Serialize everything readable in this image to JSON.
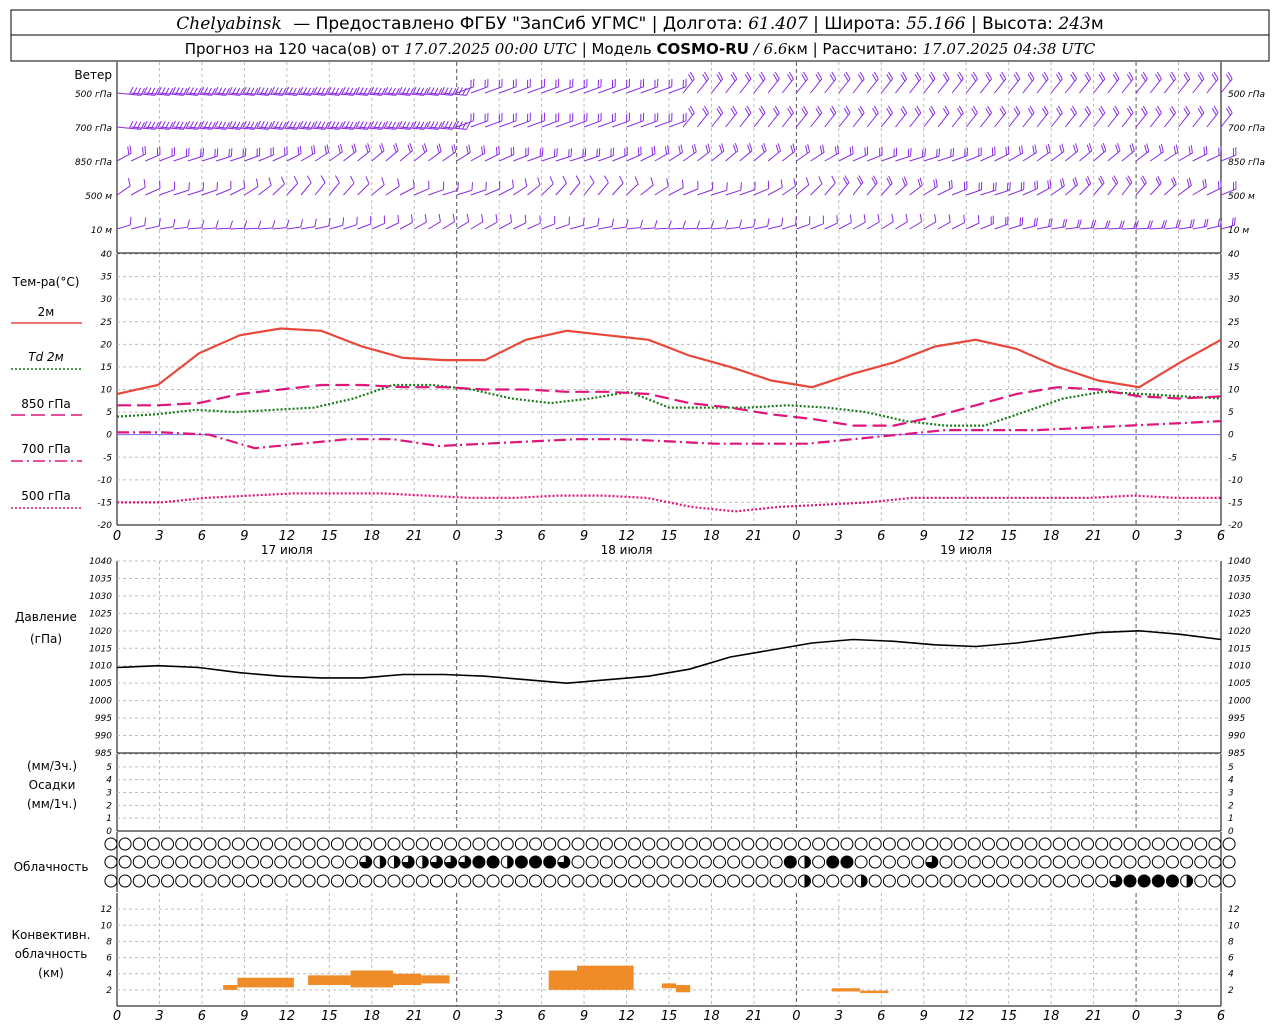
{
  "header": {
    "station": "Chelyabinsk",
    "provider": "— Предоставлено ФГБУ \"ЗапСиб УГМС\"",
    "lon_label": "Долгота:",
    "lon": "61.407",
    "lat_label": "Широта:",
    "lat": "55.166",
    "alt_label": "Высота:",
    "alt": "243",
    "alt_unit": "м",
    "forecast_label": "Прогноз на 120 часа(ов) от",
    "forecast_time": "17.07.2025 00:00 UTC",
    "model_label": "Модель",
    "model": "COSMO-RU",
    "model_res": "/ 6.6",
    "model_res_unit": "км",
    "calc_label": "Рассчитано:",
    "calc_time": "17.07.2025 04:38 UTC"
  },
  "labels": {
    "wind": "Ветер",
    "wind_levels": [
      "500 гПа",
      "700 гПа",
      "850 гПа",
      "500 м",
      "10  м"
    ],
    "temp_title": "Тем-ра(°C)",
    "legend_2m": "2м",
    "legend_td": "Td  2м",
    "legend_850": "850 гПа",
    "legend_700": "700 гПа",
    "legend_500": "500 гПа",
    "pressure_title": "Давление",
    "pressure_unit": "(гПа)",
    "precip_top": "(мм/3ч.)",
    "precip_title": "Осадки",
    "precip_bottom": "(мм/1ч.)",
    "cloud_title": "Облачность",
    "conv1": "Конвективн.",
    "conv2": "облачность",
    "conv3": "(км)"
  },
  "colors": {
    "t2m": "#e8483c",
    "td": "#1a7a1a",
    "t850": "#e0157a",
    "t700": "#e0157a",
    "t500": "#e0157a",
    "pressure": "#000000",
    "wind": "#8a2be2",
    "conv": "#f08c28"
  },
  "chart_data": [
    {
      "type": "line",
      "name": "temperature",
      "x": [
        0,
        3,
        6,
        9,
        12,
        15,
        18,
        21,
        24,
        27,
        30,
        33,
        36,
        39,
        42,
        45,
        48,
        51,
        54,
        57,
        60,
        63,
        66,
        69,
        72,
        75,
        78,
        81,
        84,
        87,
        90,
        93,
        96,
        99,
        102
      ],
      "xticks": [
        "0",
        "3",
        "6",
        "9",
        "12",
        "15",
        "18",
        "21",
        "0",
        "3",
        "6",
        "9",
        "12",
        "15",
        "18",
        "21",
        "0",
        "3",
        "6",
        "9",
        "12",
        "15",
        "18",
        "21",
        "0",
        "3",
        "6"
      ],
      "day_labels": [
        "17 июля",
        "18 июля",
        "19 июля"
      ],
      "ylim": [
        -20,
        40
      ],
      "yticks": [
        "40",
        "35",
        "30",
        "25",
        "20",
        "15",
        "10",
        "5",
        "0",
        "-5",
        "-10",
        "-15",
        "-20"
      ],
      "series": [
        {
          "name": "2м",
          "values": [
            9,
            11,
            18,
            22,
            23.5,
            23,
            19.5,
            17,
            16.5,
            16.5,
            21,
            23,
            22,
            21,
            17.5,
            15,
            12,
            10.5,
            13.5,
            16,
            19.5,
            21,
            19,
            15,
            12,
            10.5,
            16,
            21
          ]
        },
        {
          "name": "Td  2м",
          "values": [
            4,
            4.5,
            5.5,
            5,
            5.5,
            6,
            8,
            11,
            11,
            10,
            8,
            7,
            8,
            9.5,
            6,
            6,
            6,
            6.5,
            6,
            5,
            3,
            2,
            2,
            5,
            8,
            9.5,
            9,
            8.5,
            8
          ]
        },
        {
          "name": "850 гПа",
          "values": [
            6.5,
            6.5,
            7,
            9,
            10,
            11,
            11,
            10.5,
            10.5,
            10,
            10,
            9.5,
            9.5,
            9,
            7,
            6,
            4.5,
            3.5,
            2,
            2,
            4,
            6.5,
            9,
            10.5,
            10,
            8.5,
            8,
            8.5
          ]
        },
        {
          "name": "700 гПа",
          "values": [
            0.5,
            0.5,
            0,
            -3,
            -2,
            -1,
            -1,
            -2.5,
            -2,
            -1.5,
            -1,
            -1,
            -1.5,
            -2,
            -2,
            -2,
            -1,
            0,
            1,
            1,
            1,
            1.5,
            2,
            2.5,
            3
          ]
        },
        {
          "name": "500 гПа",
          "values": [
            -15,
            -15,
            -14,
            -13.5,
            -13,
            -13,
            -13,
            -13.5,
            -14,
            -14,
            -13.5,
            -13.5,
            -14,
            -16,
            -17,
            -16,
            -15.5,
            -15,
            -14,
            -14,
            -14,
            -14,
            -14,
            -13.5,
            -14,
            -14
          ]
        }
      ]
    },
    {
      "type": "line",
      "name": "pressure",
      "ylim": [
        985,
        1040
      ],
      "yticks": [
        "1040",
        "1035",
        "1030",
        "1025",
        "1020",
        "1015",
        "1010",
        "1005",
        "1000",
        "995",
        "990",
        "985"
      ],
      "values": [
        1009.5,
        1010,
        1009.5,
        1008,
        1007,
        1006.5,
        1006.5,
        1007.5,
        1007.5,
        1007,
        1006,
        1005,
        1006,
        1007,
        1009,
        1012.5,
        1014.5,
        1016.5,
        1017.5,
        1017,
        1016,
        1015.5,
        1016.5,
        1018,
        1019.5,
        1020,
        1019,
        1017.5
      ]
    },
    {
      "type": "bar",
      "name": "precipitation",
      "ylim": [
        0,
        6
      ],
      "yticks": [
        "6",
        "5",
        "4",
        "3",
        "2",
        "1",
        "0"
      ],
      "values": []
    },
    {
      "type": "bar",
      "name": "convective_cloud",
      "ylim": [
        0,
        14
      ],
      "yticks": [
        "12",
        "10",
        "8",
        "6",
        "4",
        "2"
      ],
      "bars": [
        {
          "x0": 7.5,
          "x1": 8.5,
          "top": 2.6,
          "base": 2
        },
        {
          "x0": 8.5,
          "x1": 12.5,
          "top": 3.5,
          "base": 2.3
        },
        {
          "x0": 13.5,
          "x1": 16.5,
          "top": 3.8,
          "base": 2.6
        },
        {
          "x0": 16.5,
          "x1": 19.5,
          "top": 4.4,
          "base": 2.3
        },
        {
          "x0": 19.5,
          "x1": 21.5,
          "top": 4,
          "base": 2.6
        },
        {
          "x0": 21.5,
          "x1": 23.5,
          "top": 3.8,
          "base": 2.8
        },
        {
          "x0": 30.5,
          "x1": 32.5,
          "top": 4.4,
          "base": 2
        },
        {
          "x0": 32.5,
          "x1": 36.5,
          "top": 5,
          "base": 2
        },
        {
          "x0": 38.5,
          "x1": 39.5,
          "top": 2.8,
          "base": 2.2
        },
        {
          "x0": 39.5,
          "x1": 40.5,
          "top": 2.6,
          "base": 1.7
        },
        {
          "x0": 50.5,
          "x1": 52.5,
          "top": 2.2,
          "base": 1.8
        },
        {
          "x0": 52.5,
          "x1": 54.5,
          "top": 1.9,
          "base": 1.6
        }
      ]
    },
    {
      "type": "table",
      "name": "cloudiness",
      "rows": [
        "high",
        "middle",
        "low"
      ],
      "cover": [
        [
          0,
          0,
          0,
          0,
          0,
          0,
          0,
          0,
          0,
          0,
          0,
          0,
          0,
          0,
          0,
          0,
          0,
          0,
          0,
          0,
          0,
          0,
          0,
          0,
          0,
          0,
          0,
          0,
          0,
          0,
          0,
          0,
          0,
          0,
          0,
          0,
          0,
          0,
          0,
          0,
          0,
          0,
          0,
          0,
          0,
          0,
          0,
          0,
          0,
          0,
          0,
          0,
          0,
          0,
          0,
          0,
          0,
          0,
          0,
          0,
          0,
          0,
          0,
          0,
          0,
          0,
          0,
          0,
          0,
          0,
          0,
          0,
          0,
          0,
          0,
          0,
          0,
          0,
          0,
          0
        ],
        [
          0,
          0,
          0,
          0,
          0,
          0,
          0,
          0,
          0,
          0,
          0,
          0,
          0,
          0,
          0,
          0,
          0,
          0,
          0.75,
          0.5,
          0.5,
          0.75,
          0.5,
          0.75,
          0.75,
          0.75,
          1,
          1,
          0.5,
          1,
          1,
          1,
          0.75,
          0,
          0,
          0,
          0,
          0,
          0,
          0,
          0,
          0,
          0,
          0,
          0,
          0,
          0,
          0,
          1,
          0.5,
          0,
          1,
          1,
          0,
          0,
          0,
          0,
          0,
          0.75,
          0,
          0,
          0,
          0,
          0,
          0,
          0,
          0,
          0,
          0,
          0,
          0,
          0,
          0,
          0,
          0,
          0,
          0,
          0,
          0,
          0
        ],
        [
          0,
          0,
          0,
          0,
          0,
          0,
          0,
          0,
          0,
          0,
          0,
          0,
          0,
          0,
          0,
          0,
          0,
          0,
          0,
          0,
          0,
          0,
          0,
          0,
          0,
          0,
          0,
          0,
          0,
          0,
          0,
          0,
          0,
          0,
          0,
          0,
          0,
          0,
          0,
          0,
          0,
          0,
          0,
          0,
          0,
          0,
          0,
          0,
          0,
          0.5,
          0,
          0,
          0,
          0.5,
          0,
          0,
          0,
          0,
          0,
          0,
          0,
          0,
          0,
          0,
          0,
          0,
          0,
          0,
          0,
          0,
          0,
          0.75,
          1,
          1,
          1,
          1,
          0.5,
          0,
          0,
          0
        ]
      ]
    }
  ]
}
